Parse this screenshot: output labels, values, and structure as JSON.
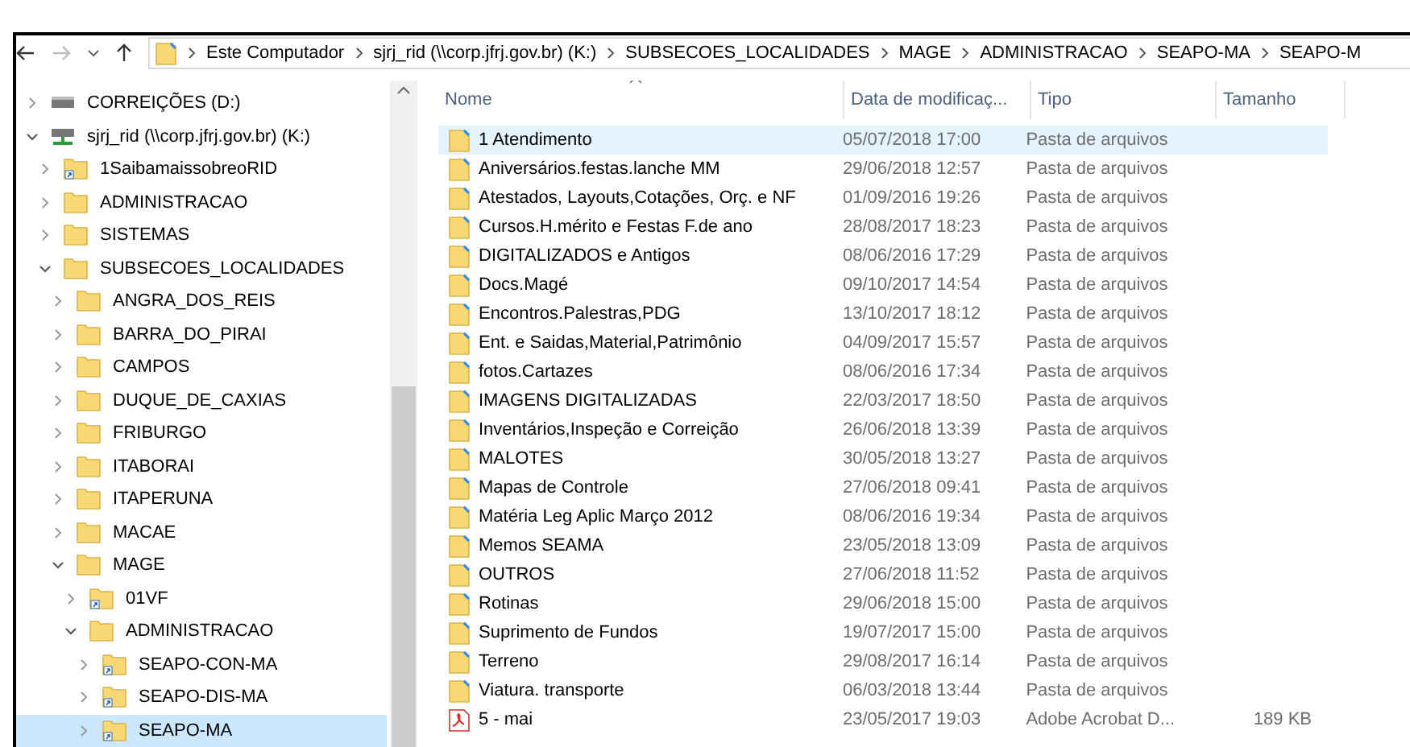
{
  "navigation": {
    "back_disabled": false,
    "forward_disabled": true
  },
  "breadcrumb": [
    "Este Computador",
    "sjrj_rid (\\\\corp.jfrj.gov.br) (K:)",
    "SUBSECOES_LOCALIDADES",
    "MAGE",
    "ADMINISTRACAO",
    "SEAPO-MA",
    "SEAPO-M"
  ],
  "tree": [
    {
      "label": "CORREIÇÕES (D:)",
      "kind": "drive",
      "expanded": false,
      "selected": false
    },
    {
      "label": "sjrj_rid (\\\\corp.jfrj.gov.br) (K:)",
      "kind": "network_drive",
      "expanded": true,
      "selected": false,
      "children": [
        {
          "label": "1SaibamaissobreoRID",
          "kind": "shortcut",
          "expanded": false,
          "selected": false
        },
        {
          "label": "ADMINISTRACAO",
          "kind": "folder",
          "expanded": false,
          "selected": false
        },
        {
          "label": "SISTEMAS",
          "kind": "folder",
          "expanded": false,
          "selected": false
        },
        {
          "label": "SUBSECOES_LOCALIDADES",
          "kind": "folder",
          "expanded": true,
          "selected": false,
          "children": [
            {
              "label": "ANGRA_DOS_REIS",
              "kind": "folder",
              "expanded": false,
              "selected": false
            },
            {
              "label": "BARRA_DO_PIRAI",
              "kind": "folder",
              "expanded": false,
              "selected": false
            },
            {
              "label": "CAMPOS",
              "kind": "folder",
              "expanded": false,
              "selected": false
            },
            {
              "label": "DUQUE_DE_CAXIAS",
              "kind": "folder",
              "expanded": false,
              "selected": false
            },
            {
              "label": "FRIBURGO",
              "kind": "folder",
              "expanded": false,
              "selected": false
            },
            {
              "label": "ITABORAI",
              "kind": "folder",
              "expanded": false,
              "selected": false
            },
            {
              "label": "ITAPERUNA",
              "kind": "folder",
              "expanded": false,
              "selected": false
            },
            {
              "label": "MACAE",
              "kind": "folder",
              "expanded": false,
              "selected": false
            },
            {
              "label": "MAGE",
              "kind": "folder",
              "expanded": true,
              "selected": false,
              "children": [
                {
                  "label": "01VF",
                  "kind": "shortcut",
                  "expanded": false,
                  "selected": false
                },
                {
                  "label": "ADMINISTRACAO",
                  "kind": "folder",
                  "expanded": true,
                  "selected": false,
                  "children": [
                    {
                      "label": "SEAPO-CON-MA",
                      "kind": "shortcut",
                      "expanded": false,
                      "selected": false
                    },
                    {
                      "label": "SEAPO-DIS-MA",
                      "kind": "shortcut",
                      "expanded": false,
                      "selected": false
                    },
                    {
                      "label": "SEAPO-MA",
                      "kind": "shortcut",
                      "expanded": false,
                      "selected": true
                    }
                  ]
                }
              ]
            }
          ]
        }
      ]
    }
  ],
  "columns": [
    "Nome",
    "Data de modificaç...",
    "Tipo",
    "Tamanho"
  ],
  "files": [
    {
      "name": "1 Atendimento",
      "date": "05/07/2018 17:00",
      "type": "Pasta de arquivos",
      "kind": "folder",
      "selected": true
    },
    {
      "name": "Aniversários.festas.lanche MM",
      "date": "29/06/2018 12:57",
      "type": "Pasta de arquivos",
      "kind": "folder",
      "selected": false
    },
    {
      "name": "Atestados, Layouts,Cotações, Orç. e NF",
      "date": "01/09/2016 19:26",
      "type": "Pasta de arquivos",
      "kind": "folder",
      "selected": false
    },
    {
      "name": "Cursos.H.mérito e Festas F.de ano",
      "date": "28/08/2017 18:23",
      "type": "Pasta de arquivos",
      "kind": "folder",
      "selected": false
    },
    {
      "name": "DIGITALIZADOS e Antigos",
      "date": "08/06/2016 17:29",
      "type": "Pasta de arquivos",
      "kind": "folder",
      "selected": false
    },
    {
      "name": "Docs.Magé",
      "date": "09/10/2017 14:54",
      "type": "Pasta de arquivos",
      "kind": "folder",
      "selected": false
    },
    {
      "name": "Encontros.Palestras,PDG",
      "date": "13/10/2017 18:12",
      "type": "Pasta de arquivos",
      "kind": "folder",
      "selected": false
    },
    {
      "name": "Ent. e Saidas,Material,Patrimônio",
      "date": "04/09/2017 15:57",
      "type": "Pasta de arquivos",
      "kind": "folder",
      "selected": false
    },
    {
      "name": "fotos.Cartazes",
      "date": "08/06/2016 17:34",
      "type": "Pasta de arquivos",
      "kind": "folder",
      "selected": false
    },
    {
      "name": "IMAGENS DIGITALIZADAS",
      "date": "22/03/2017 18:50",
      "type": "Pasta de arquivos",
      "kind": "folder",
      "selected": false
    },
    {
      "name": "Inventários,Inspeção e Correição",
      "date": "26/06/2018 13:39",
      "type": "Pasta de arquivos",
      "kind": "folder",
      "selected": false
    },
    {
      "name": "MALOTES",
      "date": "30/05/2018 13:27",
      "type": "Pasta de arquivos",
      "kind": "folder",
      "selected": false
    },
    {
      "name": "Mapas de Controle",
      "date": "27/06/2018 09:41",
      "type": "Pasta de arquivos",
      "kind": "folder",
      "selected": false
    },
    {
      "name": "Matéria Leg Aplic Março 2012",
      "date": "08/06/2016 19:34",
      "type": "Pasta de arquivos",
      "kind": "folder",
      "selected": false
    },
    {
      "name": "Memos SEAMA",
      "date": "23/05/2018 13:09",
      "type": "Pasta de arquivos",
      "kind": "folder",
      "selected": false
    },
    {
      "name": "OUTROS",
      "date": "27/06/2018 11:52",
      "type": "Pasta de arquivos",
      "kind": "folder",
      "selected": false
    },
    {
      "name": "Rotinas",
      "date": "29/06/2018 15:00",
      "type": "Pasta de arquivos",
      "kind": "folder",
      "selected": false
    },
    {
      "name": "Suprimento de Fundos",
      "date": "19/07/2017 15:00",
      "type": "Pasta de arquivos",
      "kind": "folder",
      "selected": false
    },
    {
      "name": "Terreno",
      "date": "29/08/2017 16:14",
      "type": "Pasta de arquivos",
      "kind": "folder",
      "selected": false
    },
    {
      "name": "Viatura. transporte",
      "date": "06/03/2018 13:44",
      "type": "Pasta de arquivos",
      "kind": "folder",
      "selected": false
    },
    {
      "name": "5 - mai",
      "date": "23/05/2017 19:03",
      "type": "Adobe Acrobat D...",
      "size": "189 KB",
      "kind": "pdf",
      "selected": false
    }
  ]
}
